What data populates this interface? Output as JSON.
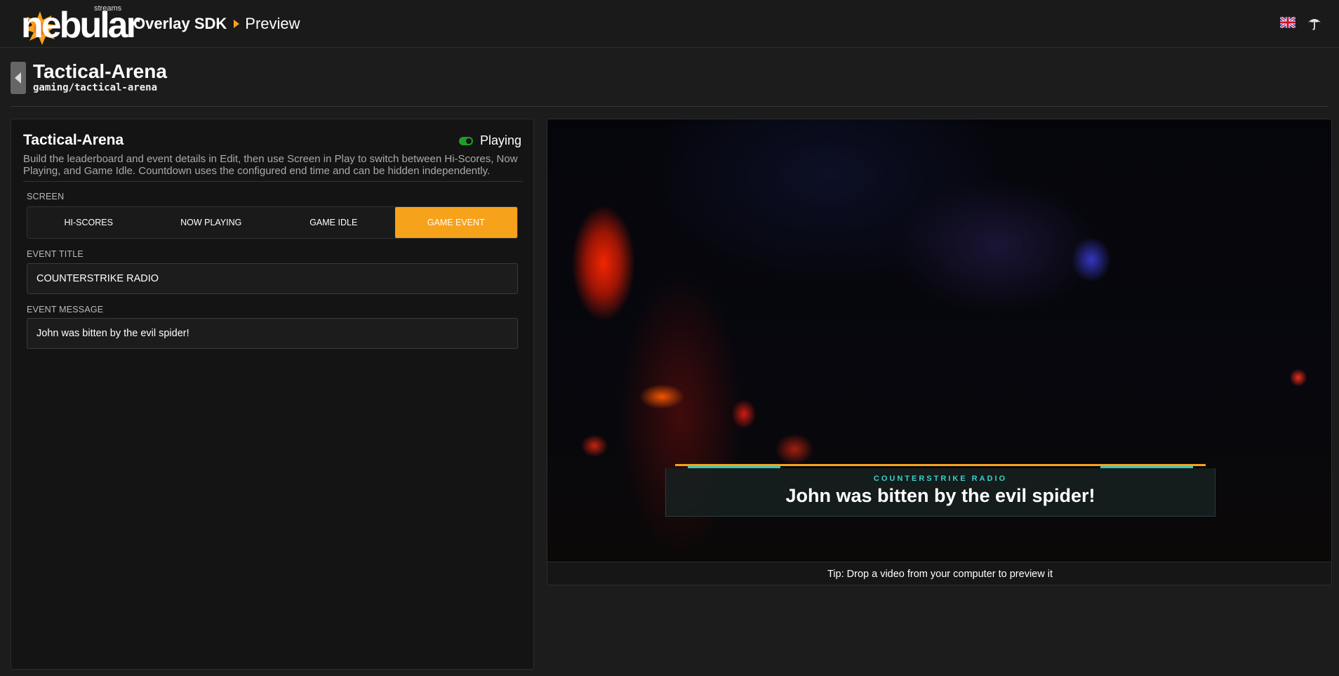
{
  "header": {
    "logo_text": "nebular",
    "logo_sub": "streams",
    "section": "Overlay SDK",
    "page": "Preview",
    "language_icon": "uk-flag-icon",
    "user_icon": "umbrella-icon"
  },
  "page": {
    "title": "Tactical-Arena",
    "path": "gaming/tactical-arena"
  },
  "editor": {
    "title": "Tactical-Arena",
    "status_label": "Playing",
    "description": "Build the leaderboard and event details in Edit, then use Screen in Play to switch between Hi-Scores, Now Playing, and Game Idle. Countdown uses the configured end time and can be hidden independently.",
    "screen_label": "SCREEN",
    "screens": [
      {
        "label": "HI-SCORES",
        "active": false
      },
      {
        "label": "NOW PLAYING",
        "active": false
      },
      {
        "label": "GAME IDLE",
        "active": false
      },
      {
        "label": "GAME EVENT",
        "active": true
      }
    ],
    "event_title_label": "EVENT TITLE",
    "event_title_value": "COUNTERSTRIKE RADIO",
    "event_message_label": "EVENT MESSAGE",
    "event_message_value": "John was bitten by the evil spider!"
  },
  "preview": {
    "overlay_title": "COUNTERSTRIKE RADIO",
    "overlay_message": "John was bitten by the evil spider!",
    "tip": "Tip: Drop a video from your computer to preview it"
  },
  "colors": {
    "accent": "#f7a21b",
    "status_on": "#1f9c2a",
    "overlay_teal": "#39c7c1"
  }
}
